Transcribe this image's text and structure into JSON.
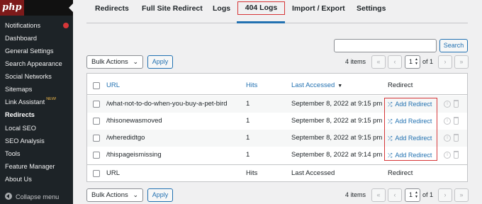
{
  "sidebar": {
    "logo": "php",
    "items": [
      {
        "label": "Notifications"
      },
      {
        "label": "Dashboard"
      },
      {
        "label": "General Settings"
      },
      {
        "label": "Search Appearance"
      },
      {
        "label": "Social Networks"
      },
      {
        "label": "Sitemaps"
      },
      {
        "label": "Link Assistant",
        "badge": "NEW!"
      },
      {
        "label": "Redirects"
      },
      {
        "label": "Local SEO"
      },
      {
        "label": "SEO Analysis"
      },
      {
        "label": "Tools"
      },
      {
        "label": "Feature Manager"
      },
      {
        "label": "About Us"
      }
    ],
    "collapse_label": "Collapse menu"
  },
  "tabs": [
    "Redirects",
    "Full Site Redirect",
    "Logs",
    "404 Logs",
    "Import / Export",
    "Settings"
  ],
  "search": {
    "button": "Search",
    "value": ""
  },
  "tablenav": {
    "bulk_actions": "Bulk Actions",
    "apply": "Apply",
    "items": "4 items",
    "first": "«",
    "prev": "‹",
    "page": "1",
    "of": "of 1",
    "next": "›",
    "last": "»"
  },
  "table": {
    "columns": {
      "url": "URL",
      "hits": "Hits",
      "last_accessed": "Last Accessed",
      "redirect": "Redirect"
    },
    "rows": [
      {
        "url": "/what-not-to-do-when-you-buy-a-pet-bird",
        "hits": "1",
        "last_accessed": "September 8, 2022 at 9:15 pm",
        "action": "Add Redirect"
      },
      {
        "url": "/thisonewasmoved",
        "hits": "1",
        "last_accessed": "September 8, 2022 at 9:15 pm",
        "action": "Add Redirect"
      },
      {
        "url": "/wheredidtgo",
        "hits": "1",
        "last_accessed": "September 8, 2022 at 9:15 pm",
        "action": "Add Redirect"
      },
      {
        "url": "/thispageismissing",
        "hits": "1",
        "last_accessed": "September 8, 2022 at 9:14 pm",
        "action": "Add Redirect"
      }
    ]
  },
  "colors": {
    "accent": "#2271b1",
    "highlight": "#d63638",
    "sidebar": "#1d2327"
  }
}
